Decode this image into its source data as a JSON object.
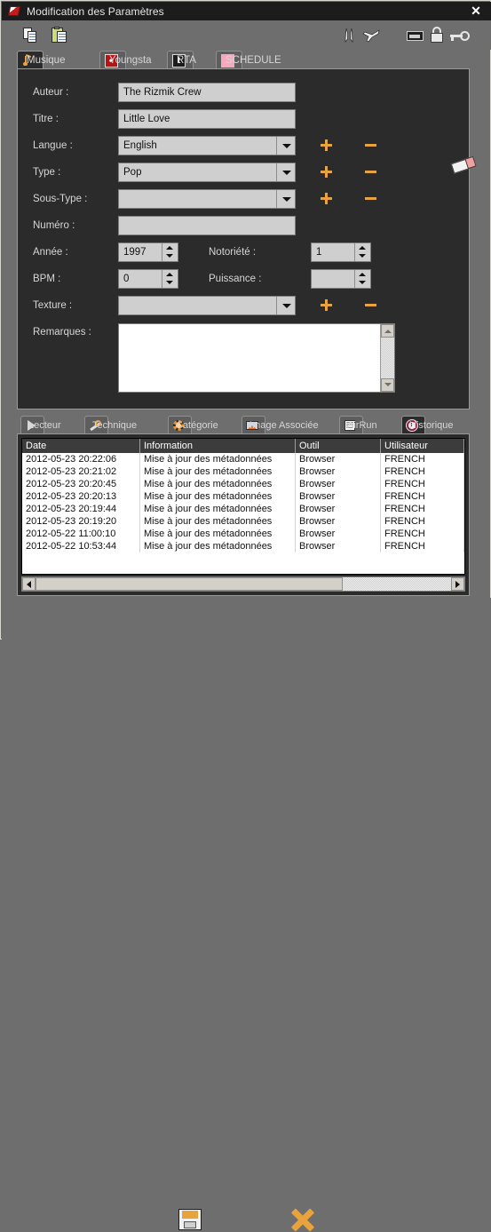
{
  "window": {
    "title": "Modification des Paramètres",
    "app_icon": "app-logo-icon",
    "close_label": "✕"
  },
  "toolbar": {
    "icons": [
      {
        "name": "copy-icon",
        "label": "Copier"
      },
      {
        "name": "paste-icon",
        "label": "Coller"
      },
      {
        "name": "rocket-icon",
        "label": "Rocket"
      },
      {
        "name": "airplane-icon",
        "label": "Avion"
      },
      {
        "name": "card-icon",
        "label": "Carte"
      },
      {
        "name": "lock-icon",
        "label": "Verrou"
      },
      {
        "name": "key-icon",
        "label": "Clé"
      }
    ]
  },
  "top_tabs": [
    {
      "label": "Musique",
      "icon": "music-note-icon",
      "active": true
    },
    {
      "label": "Youngsta",
      "icon": "youngsta-icon",
      "active": false
    },
    {
      "label": "RTA",
      "icon": "rta-icon",
      "active": false
    },
    {
      "label": "SCHEDULE",
      "icon": "schedule-swatch-icon",
      "active": false
    }
  ],
  "form": {
    "eraser_icon": "eraser-icon",
    "fields": [
      {
        "label": "Auteur :",
        "value": "The Rizmik Crew",
        "type": "text"
      },
      {
        "label": "Titre :",
        "value": "Little Love",
        "type": "text"
      },
      {
        "label": "Langue :",
        "value": "English",
        "type": "combo"
      },
      {
        "label": "Type :",
        "value": "Pop",
        "type": "combo"
      },
      {
        "label": "Sous-Type :",
        "value": "",
        "type": "combo"
      },
      {
        "label": "Numéro :",
        "value": "",
        "type": "text"
      },
      {
        "label": "Année :",
        "value": "1997",
        "type": "spin"
      },
      {
        "label": "Notoriété :",
        "value": "1",
        "type": "spin"
      },
      {
        "label": "BPM :",
        "value": "0",
        "type": "spin"
      },
      {
        "label": "Puissance :",
        "value": "",
        "type": "spin"
      },
      {
        "label": "Texture :",
        "value": "",
        "type": "combo"
      },
      {
        "label": "Remarques :",
        "value": "",
        "type": "textarea"
      }
    ],
    "add_label": "+",
    "remove_label": "−"
  },
  "bottom_tabs": [
    {
      "label": "Lecteur",
      "icon": "play-icon",
      "active": false
    },
    {
      "label": "Technique",
      "icon": "wrench-icon",
      "active": false
    },
    {
      "label": "Catégorie",
      "icon": "gear-icon",
      "active": false
    },
    {
      "label": "Image Associée",
      "icon": "image-icon",
      "active": false
    },
    {
      "label": "AirRun",
      "icon": "list-icon",
      "active": false
    },
    {
      "label": "Historique",
      "icon": "clock-icon",
      "active": true
    }
  ],
  "history_table": {
    "columns": [
      "Date",
      "Information",
      "Outil",
      "Utilisateur"
    ],
    "rows": [
      [
        "2012-05-23 20:22:06",
        "Mise à jour des métadonnées",
        "Browser",
        "FRENCH"
      ],
      [
        "2012-05-23 20:21:02",
        "Mise à jour des métadonnées",
        "Browser",
        "FRENCH"
      ],
      [
        "2012-05-23 20:20:45",
        "Mise à jour des métadonnées",
        "Browser",
        "FRENCH"
      ],
      [
        "2012-05-23 20:20:13",
        "Mise à jour des métadonnées",
        "Browser",
        "FRENCH"
      ],
      [
        "2012-05-23 20:19:44",
        "Mise à jour des métadonnées",
        "Browser",
        "FRENCH"
      ],
      [
        "2012-05-23 20:19:20",
        "Mise à jour des métadonnées",
        "Browser",
        "FRENCH"
      ],
      [
        "2012-05-22 11:00:10",
        "Mise à jour des métadonnées",
        "Browser",
        "FRENCH"
      ],
      [
        "2012-05-22 10:53:44",
        "Mise à jour des métadonnées",
        "Browser",
        "FRENCH"
      ]
    ]
  },
  "footer": {
    "save_icon": "floppy-save-icon",
    "cancel_icon": "cross-cancel-icon"
  },
  "colors": {
    "accent": "#e8a33d",
    "panel": "#2b2b2b",
    "window": "#6e6e6e",
    "titlebar": "#1c1c1c",
    "field": "#cfcfcf"
  }
}
